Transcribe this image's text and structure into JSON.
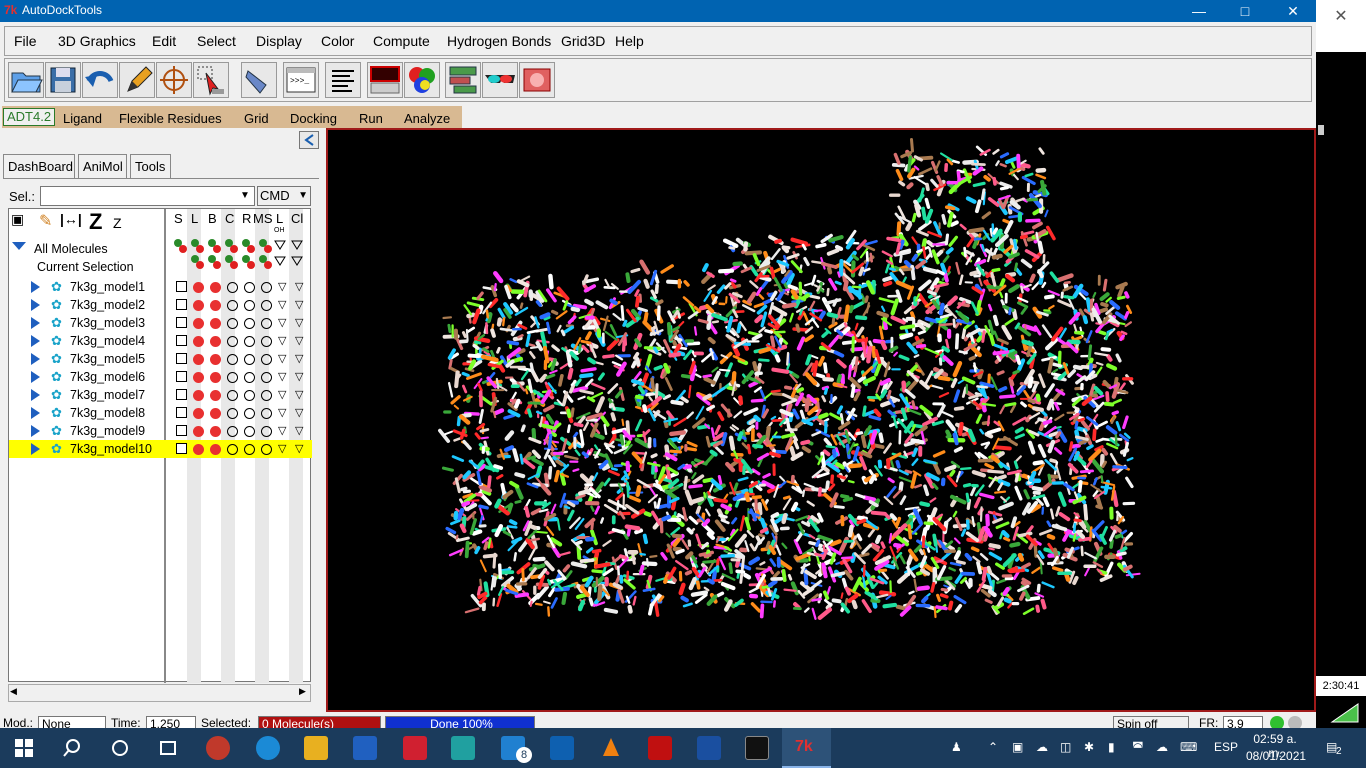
{
  "window": {
    "title": "AutoDockTools"
  },
  "menubar": [
    "File",
    "3D Graphics",
    "Edit",
    "Select",
    "Display",
    "Color",
    "Compute",
    "Hydrogen Bonds",
    "Grid3D",
    "Help"
  ],
  "toolbar_icons": [
    "open-folder-icon",
    "save-icon",
    "undo-icon",
    "pencil-icon",
    "crosshair-icon",
    "select-arrow-icon",
    "hand-pointer-icon",
    "python-shell-icon",
    "text-lines-icon",
    "monitor-icon",
    "color-cube-icon",
    "network-grid-icon",
    "3d-glasses-icon",
    "render-icon"
  ],
  "adt_tabs": {
    "active": "ADT4.2",
    "items": [
      "Ligand",
      "Flexible Residues",
      "Grid",
      "Docking",
      "Run",
      "Analyze"
    ]
  },
  "left_tabs": [
    "DashBoard",
    "AniMol",
    "Tools"
  ],
  "selection": {
    "label": "Sel.:",
    "value": "",
    "mode": "CMD"
  },
  "columns": [
    "S",
    "L",
    "B",
    "C",
    "R",
    "MS",
    "L",
    "Cl"
  ],
  "column_sublabels": [
    "",
    "",
    "",
    "",
    "",
    "",
    "OH",
    ""
  ],
  "tree": {
    "root": "All Molecules",
    "current": "Current Selection",
    "molecules": [
      "7k3g_model1",
      "7k3g_model2",
      "7k3g_model3",
      "7k3g_model4",
      "7k3g_model5",
      "7k3g_model6",
      "7k3g_model7",
      "7k3g_model8",
      "7k3g_model9",
      "7k3g_model10"
    ],
    "highlighted": "7k3g_model10"
  },
  "status": {
    "mod_label": "Mod.:",
    "mod_value": "None",
    "time_label": "Time:",
    "time_value": "1.250",
    "selected_label": "Selected:",
    "selected_value": "0 Molecule(s)",
    "progress": "Done 100%",
    "spin": "Spin off",
    "fr_label": "FR:",
    "fr_value": "3.9"
  },
  "side_clock": "2:30:41",
  "taskbar": {
    "lang": "ESP",
    "time": "02:59 a. m.",
    "date": "08/01/2021",
    "mail_badge": "8",
    "notif": "2"
  },
  "colors": {
    "title_bar": "#0063b1",
    "adt_tab_bg": "#d8b992",
    "highlight": "#ffff00",
    "viewer_border": "#a01a1a",
    "taskbar": "#1b3b5c"
  }
}
